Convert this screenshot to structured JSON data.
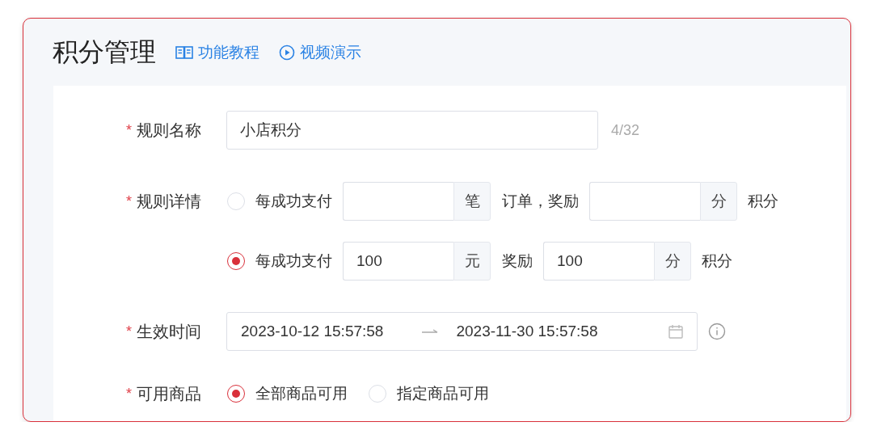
{
  "header": {
    "title": "积分管理",
    "links": [
      {
        "kind": "book",
        "label": "功能教程"
      },
      {
        "kind": "play",
        "label": "视频演示"
      }
    ]
  },
  "form": {
    "rule_name": {
      "required_mark": "*",
      "label": "规则名称",
      "value": "小店积分",
      "counter": "4/32"
    },
    "rule_detail": {
      "required_mark": "*",
      "label": "规则详情",
      "options": [
        {
          "selected": false,
          "prefix": "每成功支付",
          "first": {
            "unit": "笔"
          },
          "middle": "订单，奖励",
          "second": {
            "unit": "分"
          },
          "suffix": "积分"
        },
        {
          "selected": true,
          "prefix": "每成功支付",
          "first": {
            "value": "100",
            "unit": "元"
          },
          "middle": "奖励",
          "second": {
            "value": "100",
            "unit": "分"
          },
          "suffix": "积分"
        }
      ]
    },
    "effective_time": {
      "required_mark": "*",
      "label": "生效时间",
      "start": "2023-10-12 15:57:58",
      "end": "2023-11-30 15:57:58"
    },
    "products": {
      "required_mark": "*",
      "label": "可用商品",
      "options": [
        {
          "label": "全部商品可用",
          "selected": true
        },
        {
          "label": "指定商品可用",
          "selected": false
        }
      ]
    }
  }
}
